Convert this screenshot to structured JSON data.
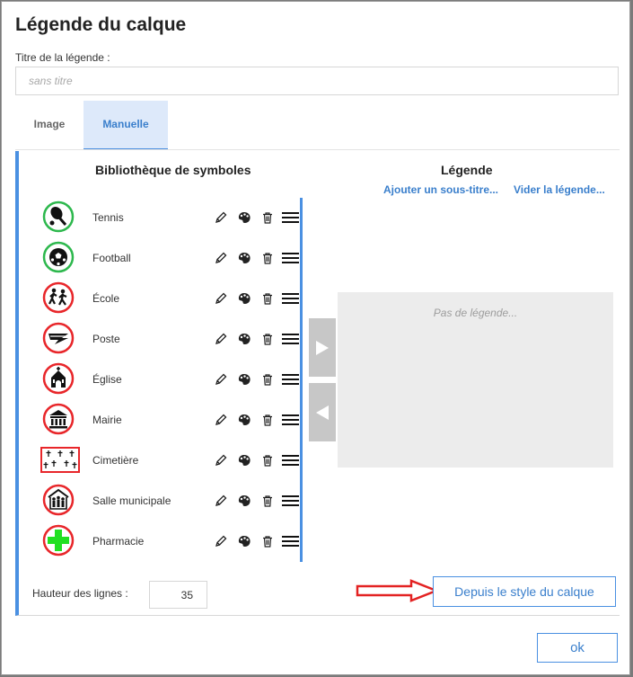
{
  "dialog": {
    "title": "Légende du calque",
    "title_field_label": "Titre de la légende :",
    "title_field_value": "",
    "title_field_placeholder": "sans titre"
  },
  "tabs": [
    {
      "label": "Image",
      "active": false
    },
    {
      "label": "Manuelle",
      "active": true
    }
  ],
  "library": {
    "title": "Bibliothèque de symboles",
    "items": [
      {
        "label": "Tennis",
        "icon": "tennis-icon"
      },
      {
        "label": "Football",
        "icon": "football-icon"
      },
      {
        "label": "École",
        "icon": "school-icon"
      },
      {
        "label": "Poste",
        "icon": "post-office-icon"
      },
      {
        "label": "Église",
        "icon": "church-icon"
      },
      {
        "label": "Mairie",
        "icon": "town-hall-icon"
      },
      {
        "label": "Cimetière",
        "icon": "cemetery-icon"
      },
      {
        "label": "Salle municipale",
        "icon": "community-hall-icon"
      },
      {
        "label": "Pharmacie",
        "icon": "pharmacy-icon"
      }
    ],
    "row_actions": [
      "pencil-icon",
      "palette-icon",
      "trash-icon",
      "drag-handle-icon"
    ]
  },
  "legend": {
    "title": "Légende",
    "add_subtitle_link": "Ajouter un sous-titre...",
    "clear_link": "Vider la légende...",
    "empty_text": "Pas de légende..."
  },
  "transfer_buttons": [
    "arrow-right-icon",
    "arrow-left-icon"
  ],
  "line_height": {
    "label": "Hauteur des lignes :",
    "value": "35"
  },
  "from_style_button": "Depuis le style du calque",
  "ok_button": "ok",
  "colors": {
    "accent": "#4a90e2",
    "link": "#3a7fcc",
    "active_tab_bg": "#dde9fa",
    "green_symbol": "#2db84d",
    "red_symbol": "#e8262a",
    "annotation_arrow": "#e32222"
  }
}
